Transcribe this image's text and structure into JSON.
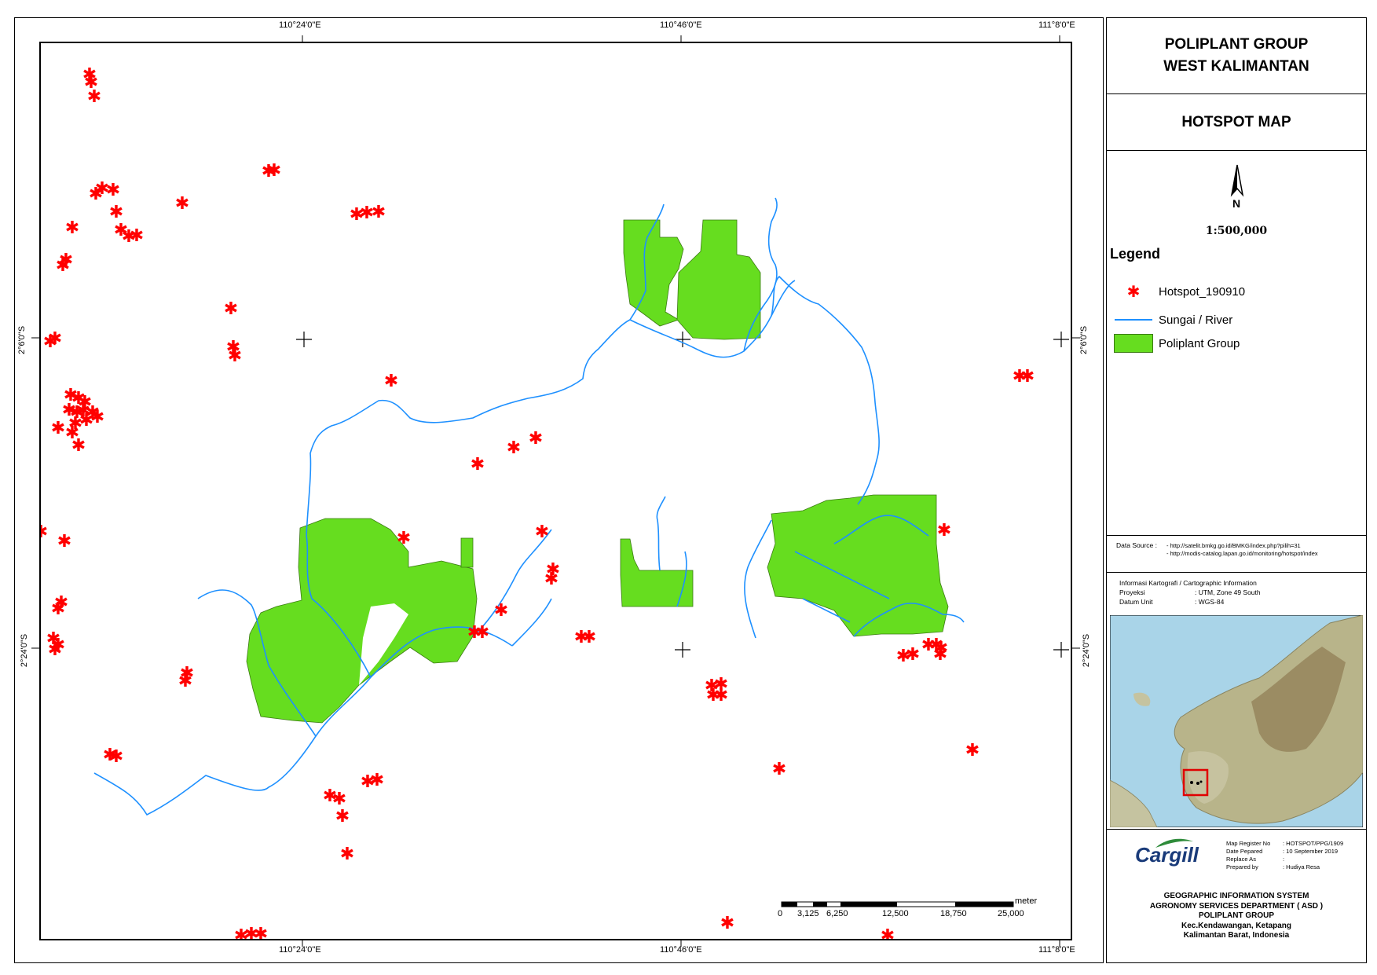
{
  "map": {
    "grid_labels": {
      "top": [
        "110°24'0\"E",
        "110°46'0\"E",
        "111°8'0\"E"
      ],
      "bottom": [
        "110°24'0\"E",
        "110°46'0\"E",
        "111°8'0\"E"
      ],
      "left": [
        "2°6'0\"S",
        "2°24'0\"S"
      ],
      "right": [
        "2°6'0\"S",
        "2°24'0\"S"
      ]
    },
    "scalebar": {
      "unit": "meter",
      "labels": [
        "0",
        "3,125",
        "6,250",
        "12,500",
        "18,750",
        "25,000"
      ]
    },
    "colors": {
      "hotspot": "#ff0000",
      "river": "#1e90ff",
      "plantation": "#66dd1f"
    }
  },
  "panel": {
    "title_line1": "POLIPLANT GROUP",
    "title_line2": "WEST KALIMANTAN",
    "subtitle": "HOTSPOT MAP",
    "north_arrow_label": "N",
    "scale": "1:500,000",
    "legend": {
      "title": "Legend",
      "items": [
        {
          "label": "Hotspot_190910",
          "symbol": "red-asterisk"
        },
        {
          "label": "Sungai / River",
          "symbol": "blue-line"
        },
        {
          "label": "Poliplant Group",
          "symbol": "green-box"
        }
      ]
    },
    "data_source": {
      "label": "Data Source :",
      "lines": [
        "- http://satelit.bmkg.go.id/BMKG/index.php?pilih=31",
        "- http://modis-catalog.lapan.go.id/monitoring/hotspot/index"
      ]
    },
    "carto_info": {
      "heading": "Informasi Kartografi / Cartographic Information",
      "rows": [
        {
          "key": "Proyeksi",
          "value": ": UTM, Zone 49 South"
        },
        {
          "key": "Datum Unit",
          "value": ": WGS-84"
        }
      ]
    },
    "logo": "Cargill",
    "map_meta": [
      {
        "key": "Map Register No",
        "value": ": HOTSPOT/PPG/1909"
      },
      {
        "key": "Date Pepared",
        "value": ": 10 September 2019"
      },
      {
        "key": "Replace As",
        "value": ":"
      },
      {
        "key": "Prepared by",
        "value": ": Hudiya Resa"
      }
    ],
    "footer": [
      "GEOGRAPHIC INFORMATION SYSTEM",
      "AGRONOMY SERVICES DEPARTMENT ( ASD )",
      "POLIPLANT GROUP",
      "Kec.Kendawangan, Ketapang",
      "Kalimantan Barat, Indonesia"
    ]
  }
}
